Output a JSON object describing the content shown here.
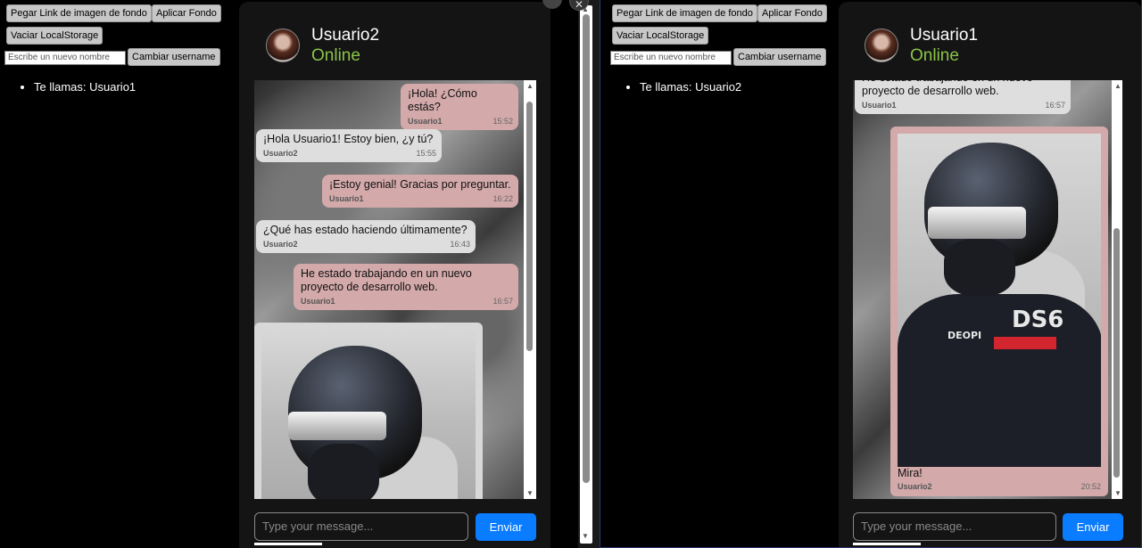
{
  "left": {
    "controls": {
      "bg_link_label": "Pegar Link de imagen de fondo",
      "apply_bg_label": "Aplicar Fondo",
      "clear_storage_label": "Vaciar LocalStorage",
      "name_placeholder": "Escribe un nuevo nombre",
      "change_name_label": "Cambiar username"
    },
    "user_list": [
      "Te llamas: Usuario1"
    ],
    "chat": {
      "contact_name": "Usuario2",
      "contact_status": "Online",
      "messages": [
        {
          "side": "me",
          "text": "¡Hola! ¿Cómo estás?",
          "sender": "Usuario1",
          "time": "15:52"
        },
        {
          "side": "other",
          "text": "¡Hola Usuario1! Estoy bien, ¿y tú?",
          "sender": "Usuario2",
          "time": "15:55"
        },
        {
          "side": "me",
          "text": "¡Estoy genial! Gracias por preguntar.",
          "sender": "Usuario1",
          "time": "16:22"
        },
        {
          "side": "other",
          "text": "¿Qué has estado haciendo últimamente?",
          "sender": "Usuario2",
          "time": "16:43"
        },
        {
          "side": "me",
          "text": "He estado trabajando en un nuevo proyecto de desarrollo web.",
          "sender": "Usuario1",
          "time": "16:57"
        }
      ],
      "input_placeholder": "Type your message...",
      "send_label": "Enviar"
    }
  },
  "right": {
    "controls": {
      "bg_link_label": "Pegar Link de imagen de fondo",
      "apply_bg_label": "Aplicar Fondo",
      "clear_storage_label": "Vaciar LocalStorage",
      "name_placeholder": "Escribe un nuevo nombre",
      "change_name_label": "Cambiar username"
    },
    "user_list": [
      "Te llamas: Usuario2"
    ],
    "chat": {
      "contact_name": "Usuario1",
      "contact_status": "Online",
      "partial_message": {
        "text": "He estado trabajando en un nuevo proyecto de desarrollo web.",
        "sender": "Usuario1",
        "time": "16:57"
      },
      "image_message": {
        "caption": "Mira!",
        "sender": "Usuario2",
        "time": "20:52",
        "logo": "DS6",
        "logo_small": "DEOPI"
      },
      "input_placeholder": "Type your message...",
      "send_label": "Enviar"
    }
  },
  "colors": {
    "status_online": "#8bc34a",
    "send_button": "#0a7cff",
    "my_bubble": "#d3a9aa",
    "other_bubble": "#dedede"
  }
}
